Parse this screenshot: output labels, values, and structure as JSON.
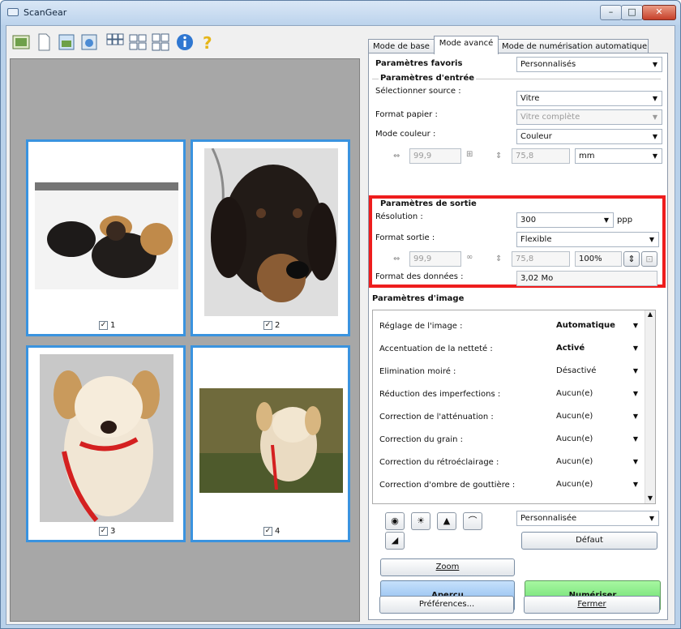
{
  "window": {
    "title": "ScanGear",
    "min": "–",
    "max": "□",
    "close": "✕"
  },
  "thumbnails": [
    {
      "label": "1",
      "checked": "✓"
    },
    {
      "label": "2",
      "checked": "✓"
    },
    {
      "label": "3",
      "checked": "✓"
    },
    {
      "label": "4",
      "checked": "✓"
    }
  ],
  "tabs": [
    "Mode de base",
    "Mode avancé",
    "Mode de numérisation automatique"
  ],
  "favorites": {
    "label": "Paramètres favoris",
    "value": "Personnalisés"
  },
  "input": {
    "title": "Paramètres d'entrée",
    "source_label": "Sélectionner source :",
    "source_value": "Vitre",
    "paper_label": "Format papier :",
    "paper_value": "Vitre complète",
    "color_label": "Mode couleur :",
    "color_value": "Couleur",
    "width": "99,9",
    "height": "75,8",
    "unit": "mm"
  },
  "output": {
    "title": "Paramètres de sortie",
    "res_label": "Résolution :",
    "res_value": "300",
    "res_unit": "ppp",
    "format_label": "Format sortie :",
    "format_value": "Flexible",
    "width": "99,9",
    "height": "75,8",
    "scale": "100%",
    "data_label": "Format des données :",
    "data_value": "3,02 Mo"
  },
  "image_settings": {
    "title": "Paramètres d'image",
    "rows": [
      {
        "label": "Réglage de l'image :",
        "value": "Automatique"
      },
      {
        "label": "Accentuation de la netteté :",
        "value": "Activé"
      },
      {
        "label": "Elimination moiré :",
        "value": "Désactivé"
      },
      {
        "label": "Réduction des imperfections :",
        "value": "Aucun(e)"
      },
      {
        "label": "Correction de l'atténuation :",
        "value": "Aucun(e)"
      },
      {
        "label": "Correction du grain :",
        "value": "Aucun(e)"
      },
      {
        "label": "Correction du rétroéclairage :",
        "value": "Aucun(e)"
      },
      {
        "label": "Correction d'ombre de gouttière :",
        "value": "Aucun(e)"
      }
    ]
  },
  "tone": {
    "preset": "Personnalisée",
    "default_btn": "Défaut"
  },
  "buttons": {
    "zoom": "Zoom",
    "preview": "Aperçu",
    "scan": "Numériser",
    "prefs": "Préférences...",
    "close": "Fermer"
  }
}
